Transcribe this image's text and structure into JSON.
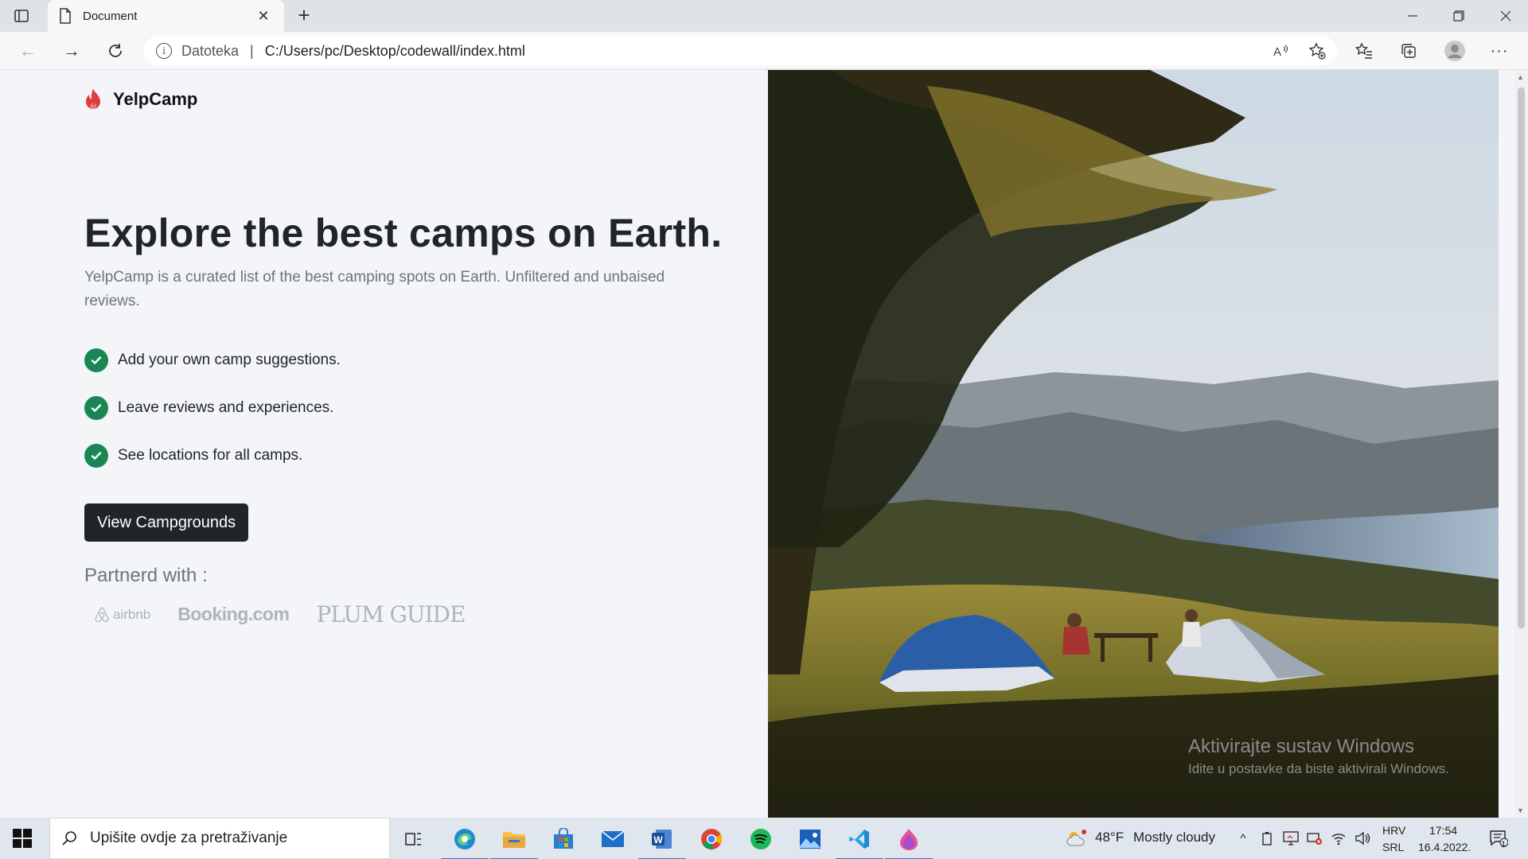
{
  "browser": {
    "tab_title": "Document",
    "new_tab": "+",
    "address": {
      "scheme_label": "Datoteka",
      "separator": "|",
      "url": "C:/Users/pc/Desktop/codewall/index.html"
    }
  },
  "brand": {
    "name": "YelpCamp",
    "accent": "#e03b3b"
  },
  "hero": {
    "title": "Explore the best camps on Earth.",
    "subtitle": "YelpCamp is a curated list of the best camping spots on Earth. Unfiltered and unbaised reviews."
  },
  "features": [
    {
      "text": "Add your own camp suggestions."
    },
    {
      "text": "Leave reviews and experiences."
    },
    {
      "text": "See locations for all camps."
    }
  ],
  "cta": {
    "label": "View Campgrounds"
  },
  "partners": {
    "title": "Partnerd with :",
    "airbnb": "airbnb",
    "booking": "Booking.com",
    "plum": "PLUM GUIDE"
  },
  "activation": {
    "title": "Aktivirajte sustav Windows",
    "subtitle": "Idite u postavke da biste aktivirali Windows."
  },
  "taskbar": {
    "search_placeholder": "Upišite ovdje za pretraživanje",
    "weather_temp": "48°F",
    "weather_text": "Mostly cloudy",
    "lang_top": "HRV",
    "lang_bottom": "SRL",
    "time": "17:54",
    "date": "16.4.2022.",
    "notification_count": "1"
  },
  "colors": {
    "check": "#198754",
    "cta_bg": "#212529",
    "taskbar": "#dfe6ee"
  }
}
